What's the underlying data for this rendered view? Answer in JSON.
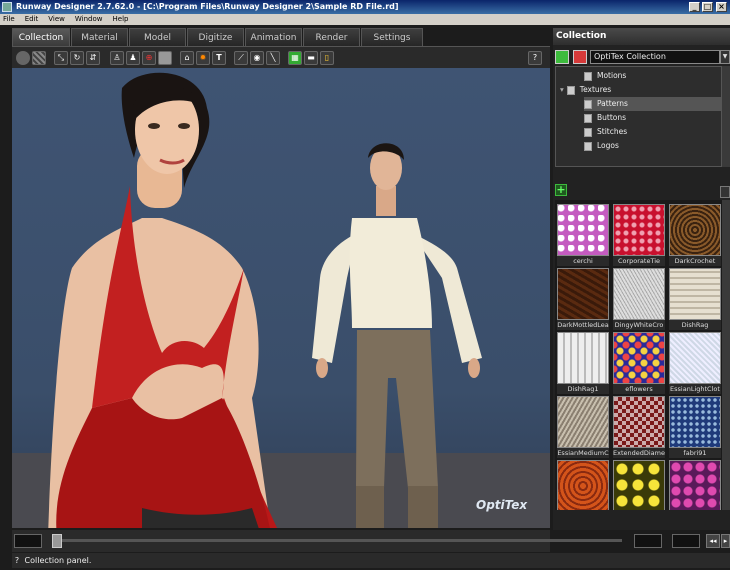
{
  "window": {
    "title": "Runway Designer 2.7.62.0 - [C:\\Program Files\\Runway Designer 2\\Sample RD File.rd]"
  },
  "menu": [
    "File",
    "Edit",
    "View",
    "Window",
    "Help"
  ],
  "tabs": [
    "Collection",
    "Material",
    "Model",
    "Digitize",
    "Animation",
    "Render",
    "Settings"
  ],
  "active_tab": "Collection",
  "panel": {
    "title": "Collection",
    "collection_select": "OptiTex Collection",
    "tree": [
      {
        "label": "Motions",
        "selected": false
      },
      {
        "label": "Textures",
        "selected": false
      },
      {
        "label": "Patterns",
        "selected": true
      },
      {
        "label": "Buttons",
        "selected": false
      },
      {
        "label": "Stitches",
        "selected": false
      },
      {
        "label": "Logos",
        "selected": false
      }
    ],
    "add_symbol": "+",
    "swatches": [
      "cerchi",
      "CorporateTie",
      "DarkCrochet",
      "DarkMottledLea",
      "DingyWhiteCro",
      "DishRag",
      "DishRag1",
      "eflowers",
      "EssianLightClot",
      "EssianMediumC",
      "ExtendedDiame",
      "fabri91",
      "",
      "",
      ""
    ]
  },
  "status": {
    "text": "Collection panel.",
    "help_glyph": "?"
  },
  "logo": "OptiTex",
  "colors": {
    "accent_green": "#3dbb3d",
    "accent_red": "#d63a3a",
    "viewport": "#3f5473",
    "top_red": "#b51a1a"
  }
}
